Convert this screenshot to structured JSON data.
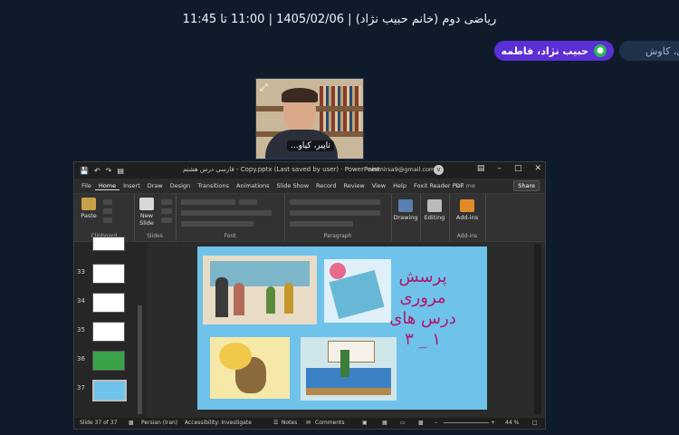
{
  "session": {
    "title": "ریاضی دوم (خانم حبیب نژاد) | 1405/02/06 | 11:00 تا 11:45"
  },
  "participants": {
    "active_label": "حبیب نژاد، فاطمه",
    "other_label": "ی، کاوش"
  },
  "webcam": {
    "name_label": "تاپیر، کیاو..."
  },
  "powerpoint": {
    "doc_title": "فارسی درس هشتم - Copy.pptx (Last saved by user) · PowerPoint",
    "account": "nmmirsa9@gmail.com",
    "avatar_initial": "v",
    "tabs": [
      "File",
      "Home",
      "Insert",
      "Draw",
      "Design",
      "Transitions",
      "Animations",
      "Slide Show",
      "Record",
      "Review",
      "View",
      "Help",
      "Foxit Reader PDF"
    ],
    "active_tab": "Home",
    "tell_me": "Tell me",
    "share_label": "Share",
    "ribbon": {
      "paste": "Paste",
      "new_slide": "New Slide",
      "drawing": "Drawing",
      "editing": "Editing",
      "addins": "Add-ins",
      "groups": [
        "Clipboard",
        "Slides",
        "Font",
        "Paragraph",
        "Add-ins"
      ]
    },
    "thumbnails": [
      {
        "num": "33"
      },
      {
        "num": "34"
      },
      {
        "num": "35"
      },
      {
        "num": "36"
      },
      {
        "num": "37"
      }
    ],
    "slide_text": {
      "line1": "پرسش",
      "line2": "مروری",
      "line3": "درس های",
      "line4": "۱ _ ۳"
    },
    "status": {
      "slide_count": "Slide 37 of 37",
      "language": "Persian (Iran)",
      "accessibility": "Accessibility: Investigate",
      "notes": "Notes",
      "comments": "Comments",
      "zoom": "44 %"
    }
  },
  "colors": {
    "background": "#0f1b2b",
    "accent": "#5b2fd6",
    "mic_green": "#2fb65a",
    "slide_bg": "#6fc3ea",
    "slide_text": "#b0156e"
  }
}
